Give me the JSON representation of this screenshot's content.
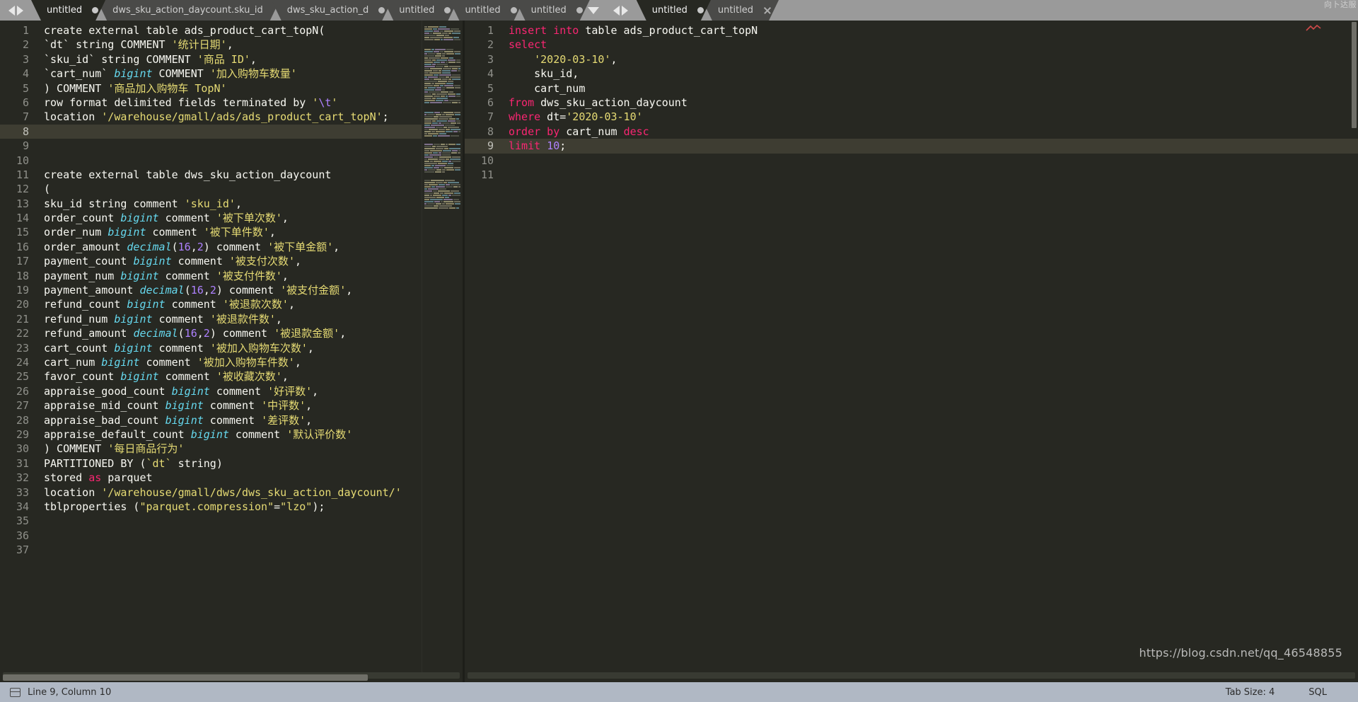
{
  "window": {
    "watermark_tabbar_line1": "向卜达服",
    "url_watermark": "https://blog.csdn.net/qq_46548855"
  },
  "tabbar": {
    "nav_prev_icon": "arrow-left-icon",
    "nav_next_icon": "arrow-right-icon",
    "overflow_icon": "chevron-down-icon",
    "left_group": [
      {
        "label": "untitled",
        "state": "active",
        "close_glyph": "dot"
      },
      {
        "label": "dws_sku_action_daycount.sku_id",
        "state": "inactive",
        "close_glyph": "none"
      },
      {
        "label": "dws_sku_action_d",
        "state": "inactive",
        "close_glyph": "dot"
      },
      {
        "label": "untitled",
        "state": "inactive",
        "close_glyph": "dot"
      },
      {
        "label": "untitled",
        "state": "inactive",
        "close_glyph": "dot"
      },
      {
        "label": "untitled",
        "state": "inactive",
        "close_glyph": "dot"
      }
    ],
    "right_group": [
      {
        "label": "untitled",
        "state": "active",
        "close_glyph": "dot"
      },
      {
        "label": "untitled",
        "state": "inactive",
        "close_glyph": "x"
      }
    ]
  },
  "left_editor": {
    "current_line": 8,
    "total_lines": 37,
    "lines": [
      {
        "n": 1,
        "tokens": [
          {
            "t": "create external table ads_product_cart_topN(",
            "c": "pl"
          }
        ]
      },
      {
        "n": 2,
        "tokens": [
          {
            "t": "`dt` string COMMENT ",
            "c": "pl"
          },
          {
            "t": "'统计日期'",
            "c": "st"
          },
          {
            "t": ",",
            "c": "pl"
          }
        ]
      },
      {
        "n": 3,
        "tokens": [
          {
            "t": "`sku_id` string COMMENT ",
            "c": "pl"
          },
          {
            "t": "'商品 ID'",
            "c": "st"
          },
          {
            "t": ",",
            "c": "pl"
          }
        ]
      },
      {
        "n": 4,
        "tokens": [
          {
            "t": "`cart_num` ",
            "c": "pl"
          },
          {
            "t": "bigint",
            "c": "ty"
          },
          {
            "t": " COMMENT ",
            "c": "pl"
          },
          {
            "t": "'加入购物车数量'",
            "c": "st"
          }
        ]
      },
      {
        "n": 5,
        "tokens": [
          {
            "t": ") COMMENT ",
            "c": "pl"
          },
          {
            "t": "'商品加入购物车 TopN'",
            "c": "st"
          }
        ]
      },
      {
        "n": 6,
        "tokens": [
          {
            "t": "row format delimited fields terminated by ",
            "c": "pl"
          },
          {
            "t": "'",
            "c": "st"
          },
          {
            "t": "\\t",
            "c": "nu"
          },
          {
            "t": "'",
            "c": "st"
          }
        ]
      },
      {
        "n": 7,
        "tokens": [
          {
            "t": "location ",
            "c": "pl"
          },
          {
            "t": "'/warehouse/gmall/ads/ads_product_cart_topN'",
            "c": "st"
          },
          {
            "t": ";",
            "c": "pl"
          }
        ]
      },
      {
        "n": 8,
        "tokens": []
      },
      {
        "n": 9,
        "tokens": []
      },
      {
        "n": 10,
        "tokens": []
      },
      {
        "n": 11,
        "tokens": [
          {
            "t": "create external table dws_sku_action_daycount",
            "c": "pl"
          }
        ]
      },
      {
        "n": 12,
        "tokens": [
          {
            "t": "(",
            "c": "pl"
          }
        ]
      },
      {
        "n": 13,
        "tokens": [
          {
            "t": "sku_id string comment ",
            "c": "pl"
          },
          {
            "t": "'sku_id'",
            "c": "st"
          },
          {
            "t": ",",
            "c": "pl"
          }
        ]
      },
      {
        "n": 14,
        "tokens": [
          {
            "t": "order_count ",
            "c": "pl"
          },
          {
            "t": "bigint",
            "c": "ty"
          },
          {
            "t": " comment ",
            "c": "pl"
          },
          {
            "t": "'被下单次数'",
            "c": "st"
          },
          {
            "t": ",",
            "c": "pl"
          }
        ]
      },
      {
        "n": 15,
        "tokens": [
          {
            "t": "order_num ",
            "c": "pl"
          },
          {
            "t": "bigint",
            "c": "ty"
          },
          {
            "t": " comment ",
            "c": "pl"
          },
          {
            "t": "'被下单件数'",
            "c": "st"
          },
          {
            "t": ",",
            "c": "pl"
          }
        ]
      },
      {
        "n": 16,
        "tokens": [
          {
            "t": "order_amount ",
            "c": "pl"
          },
          {
            "t": "decimal",
            "c": "ty"
          },
          {
            "t": "(",
            "c": "pl"
          },
          {
            "t": "16",
            "c": "nu"
          },
          {
            "t": ",",
            "c": "pl"
          },
          {
            "t": "2",
            "c": "nu"
          },
          {
            "t": ") comment ",
            "c": "pl"
          },
          {
            "t": "'被下单金额'",
            "c": "st"
          },
          {
            "t": ",",
            "c": "pl"
          }
        ]
      },
      {
        "n": 17,
        "tokens": [
          {
            "t": "payment_count ",
            "c": "pl"
          },
          {
            "t": "bigint",
            "c": "ty"
          },
          {
            "t": " comment ",
            "c": "pl"
          },
          {
            "t": "'被支付次数'",
            "c": "st"
          },
          {
            "t": ",",
            "c": "pl"
          }
        ]
      },
      {
        "n": 18,
        "tokens": [
          {
            "t": "payment_num ",
            "c": "pl"
          },
          {
            "t": "bigint",
            "c": "ty"
          },
          {
            "t": " comment ",
            "c": "pl"
          },
          {
            "t": "'被支付件数'",
            "c": "st"
          },
          {
            "t": ",",
            "c": "pl"
          }
        ]
      },
      {
        "n": 19,
        "tokens": [
          {
            "t": "payment_amount ",
            "c": "pl"
          },
          {
            "t": "decimal",
            "c": "ty"
          },
          {
            "t": "(",
            "c": "pl"
          },
          {
            "t": "16",
            "c": "nu"
          },
          {
            "t": ",",
            "c": "pl"
          },
          {
            "t": "2",
            "c": "nu"
          },
          {
            "t": ") comment ",
            "c": "pl"
          },
          {
            "t": "'被支付金额'",
            "c": "st"
          },
          {
            "t": ",",
            "c": "pl"
          }
        ]
      },
      {
        "n": 20,
        "tokens": [
          {
            "t": "refund_count ",
            "c": "pl"
          },
          {
            "t": "bigint",
            "c": "ty"
          },
          {
            "t": " comment ",
            "c": "pl"
          },
          {
            "t": "'被退款次数'",
            "c": "st"
          },
          {
            "t": ",",
            "c": "pl"
          }
        ]
      },
      {
        "n": 21,
        "tokens": [
          {
            "t": "refund_num ",
            "c": "pl"
          },
          {
            "t": "bigint",
            "c": "ty"
          },
          {
            "t": " comment ",
            "c": "pl"
          },
          {
            "t": "'被退款件数'",
            "c": "st"
          },
          {
            "t": ",",
            "c": "pl"
          }
        ]
      },
      {
        "n": 22,
        "tokens": [
          {
            "t": "refund_amount ",
            "c": "pl"
          },
          {
            "t": "decimal",
            "c": "ty"
          },
          {
            "t": "(",
            "c": "pl"
          },
          {
            "t": "16",
            "c": "nu"
          },
          {
            "t": ",",
            "c": "pl"
          },
          {
            "t": "2",
            "c": "nu"
          },
          {
            "t": ") comment ",
            "c": "pl"
          },
          {
            "t": "'被退款金额'",
            "c": "st"
          },
          {
            "t": ",",
            "c": "pl"
          }
        ]
      },
      {
        "n": 23,
        "tokens": [
          {
            "t": "cart_count ",
            "c": "pl"
          },
          {
            "t": "bigint",
            "c": "ty"
          },
          {
            "t": " comment ",
            "c": "pl"
          },
          {
            "t": "'被加入购物车次数'",
            "c": "st"
          },
          {
            "t": ",",
            "c": "pl"
          }
        ]
      },
      {
        "n": 24,
        "tokens": [
          {
            "t": "cart_num ",
            "c": "pl"
          },
          {
            "t": "bigint",
            "c": "ty"
          },
          {
            "t": " comment ",
            "c": "pl"
          },
          {
            "t": "'被加入购物车件数'",
            "c": "st"
          },
          {
            "t": ",",
            "c": "pl"
          }
        ]
      },
      {
        "n": 25,
        "tokens": [
          {
            "t": "favor_count ",
            "c": "pl"
          },
          {
            "t": "bigint",
            "c": "ty"
          },
          {
            "t": " comment ",
            "c": "pl"
          },
          {
            "t": "'被收藏次数'",
            "c": "st"
          },
          {
            "t": ",",
            "c": "pl"
          }
        ]
      },
      {
        "n": 26,
        "tokens": [
          {
            "t": "appraise_good_count ",
            "c": "pl"
          },
          {
            "t": "bigint",
            "c": "ty"
          },
          {
            "t": " comment ",
            "c": "pl"
          },
          {
            "t": "'好评数'",
            "c": "st"
          },
          {
            "t": ",",
            "c": "pl"
          }
        ]
      },
      {
        "n": 27,
        "tokens": [
          {
            "t": "appraise_mid_count ",
            "c": "pl"
          },
          {
            "t": "bigint",
            "c": "ty"
          },
          {
            "t": " comment ",
            "c": "pl"
          },
          {
            "t": "'中评数'",
            "c": "st"
          },
          {
            "t": ",",
            "c": "pl"
          }
        ]
      },
      {
        "n": 28,
        "tokens": [
          {
            "t": "appraise_bad_count ",
            "c": "pl"
          },
          {
            "t": "bigint",
            "c": "ty"
          },
          {
            "t": " comment ",
            "c": "pl"
          },
          {
            "t": "'差评数'",
            "c": "st"
          },
          {
            "t": ",",
            "c": "pl"
          }
        ]
      },
      {
        "n": 29,
        "tokens": [
          {
            "t": "appraise_default_count ",
            "c": "pl"
          },
          {
            "t": "bigint",
            "c": "ty"
          },
          {
            "t": " comment ",
            "c": "pl"
          },
          {
            "t": "'默认评价数'",
            "c": "st"
          }
        ]
      },
      {
        "n": 30,
        "tokens": [
          {
            "t": ") COMMENT ",
            "c": "pl"
          },
          {
            "t": "'每日商品行为'",
            "c": "st"
          }
        ]
      },
      {
        "n": 31,
        "tokens": [
          {
            "t": "PARTITIONED BY (",
            "c": "pl"
          },
          {
            "t": "`dt`",
            "c": "st"
          },
          {
            "t": " string)",
            "c": "pl"
          }
        ]
      },
      {
        "n": 32,
        "tokens": [
          {
            "t": "stored ",
            "c": "pl"
          },
          {
            "t": "as",
            "c": "k"
          },
          {
            "t": " parquet",
            "c": "pl"
          }
        ]
      },
      {
        "n": 33,
        "tokens": [
          {
            "t": "location ",
            "c": "pl"
          },
          {
            "t": "'/warehouse/gmall/dws/dws_sku_action_daycount/'",
            "c": "st"
          }
        ]
      },
      {
        "n": 34,
        "tokens": [
          {
            "t": "tblproperties (",
            "c": "pl"
          },
          {
            "t": "\"parquet.compression\"",
            "c": "st"
          },
          {
            "t": "=",
            "c": "pl"
          },
          {
            "t": "\"lzo\"",
            "c": "st"
          },
          {
            "t": ");",
            "c": "pl"
          }
        ]
      },
      {
        "n": 35,
        "tokens": []
      },
      {
        "n": 36,
        "tokens": []
      },
      {
        "n": 37,
        "tokens": []
      }
    ]
  },
  "right_editor": {
    "current_line": 9,
    "total_lines": 11,
    "lines": [
      {
        "n": 1,
        "tokens": [
          {
            "t": "insert into",
            "c": "k"
          },
          {
            "t": " table ads_product_cart_topN",
            "c": "pl"
          }
        ]
      },
      {
        "n": 2,
        "tokens": [
          {
            "t": "select",
            "c": "k"
          }
        ]
      },
      {
        "n": 3,
        "tokens": [
          {
            "t": "    ",
            "c": "ind"
          },
          {
            "t": "'2020-03-10'",
            "c": "st"
          },
          {
            "t": ",",
            "c": "pl"
          }
        ]
      },
      {
        "n": 4,
        "tokens": [
          {
            "t": "    ",
            "c": "ind"
          },
          {
            "t": "sku_id,",
            "c": "pl"
          }
        ]
      },
      {
        "n": 5,
        "tokens": [
          {
            "t": "    ",
            "c": "ind"
          },
          {
            "t": "cart_num",
            "c": "pl"
          }
        ]
      },
      {
        "n": 6,
        "tokens": [
          {
            "t": "from",
            "c": "k"
          },
          {
            "t": " dws_sku_action_daycount",
            "c": "pl"
          }
        ]
      },
      {
        "n": 7,
        "tokens": [
          {
            "t": "where",
            "c": "k"
          },
          {
            "t": " dt=",
            "c": "pl"
          },
          {
            "t": "'2020-03-10'",
            "c": "st"
          }
        ]
      },
      {
        "n": 8,
        "tokens": [
          {
            "t": "order by",
            "c": "k"
          },
          {
            "t": " cart_num ",
            "c": "pl"
          },
          {
            "t": "desc",
            "c": "k"
          }
        ]
      },
      {
        "n": 9,
        "tokens": [
          {
            "t": "limit",
            "c": "k"
          },
          {
            "t": " ",
            "c": "pl"
          },
          {
            "t": "10",
            "c": "nu"
          },
          {
            "t": ";",
            "c": "pl"
          }
        ]
      },
      {
        "n": 10,
        "tokens": []
      },
      {
        "n": 11,
        "tokens": []
      }
    ]
  },
  "statusbar": {
    "doc_icon": "document-icon",
    "position": "Line 9, Column 10",
    "tab_size": "Tab Size: 4",
    "syntax": "SQL"
  },
  "colors": {
    "editor_bg": "#272822",
    "current_line": "#3e3d32",
    "keyword": "#f92672",
    "type": "#66d9ef",
    "string": "#e6db74",
    "number": "#ae81ff",
    "plain": "#f8f8f2",
    "gutter": "#8f908a",
    "tabbar_bg": "#9a9a9a",
    "tab_inactive": "#4a4a48",
    "statusbar_bg": "#b0b8c4"
  }
}
